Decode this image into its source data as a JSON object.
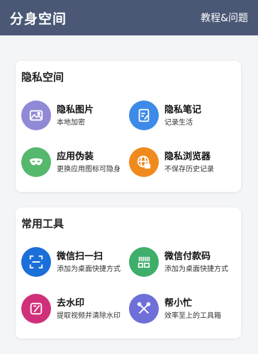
{
  "header": {
    "title": "分身空间",
    "help_label": "教程&问题"
  },
  "privacy_section": {
    "title": "隐私空间",
    "items": [
      {
        "title": "隐私图片",
        "subtitle": "本地加密",
        "icon": "image-icon",
        "color": "#9089d6"
      },
      {
        "title": "隐私笔记",
        "subtitle": "记录生活",
        "icon": "note-icon",
        "color": "#3d8ae8"
      },
      {
        "title": "应用伪装",
        "subtitle": "更换应用图标可隐身",
        "icon": "mask-icon",
        "color": "#55b86d"
      },
      {
        "title": "隐私浏览器",
        "subtitle": "不保存历史记录",
        "icon": "globe-lock-icon",
        "color": "#f08a1e"
      }
    ]
  },
  "tools_section": {
    "title": "常用工具",
    "items": [
      {
        "title": "微信扫一扫",
        "subtitle": "添加为桌面快捷方式",
        "icon": "scan-icon",
        "color": "#1b6fd8"
      },
      {
        "title": "微信付款码",
        "subtitle": "添加为桌面快捷方式",
        "icon": "barcode-icon",
        "color": "#3fae6a"
      },
      {
        "title": "去水印",
        "subtitle": "提取视频并清除水印",
        "icon": "watermark-icon",
        "color": "#d0307a"
      },
      {
        "title": "帮小忙",
        "subtitle": "效率至上的工具箱",
        "icon": "tools-icon",
        "color": "#6e6fd8"
      }
    ]
  }
}
